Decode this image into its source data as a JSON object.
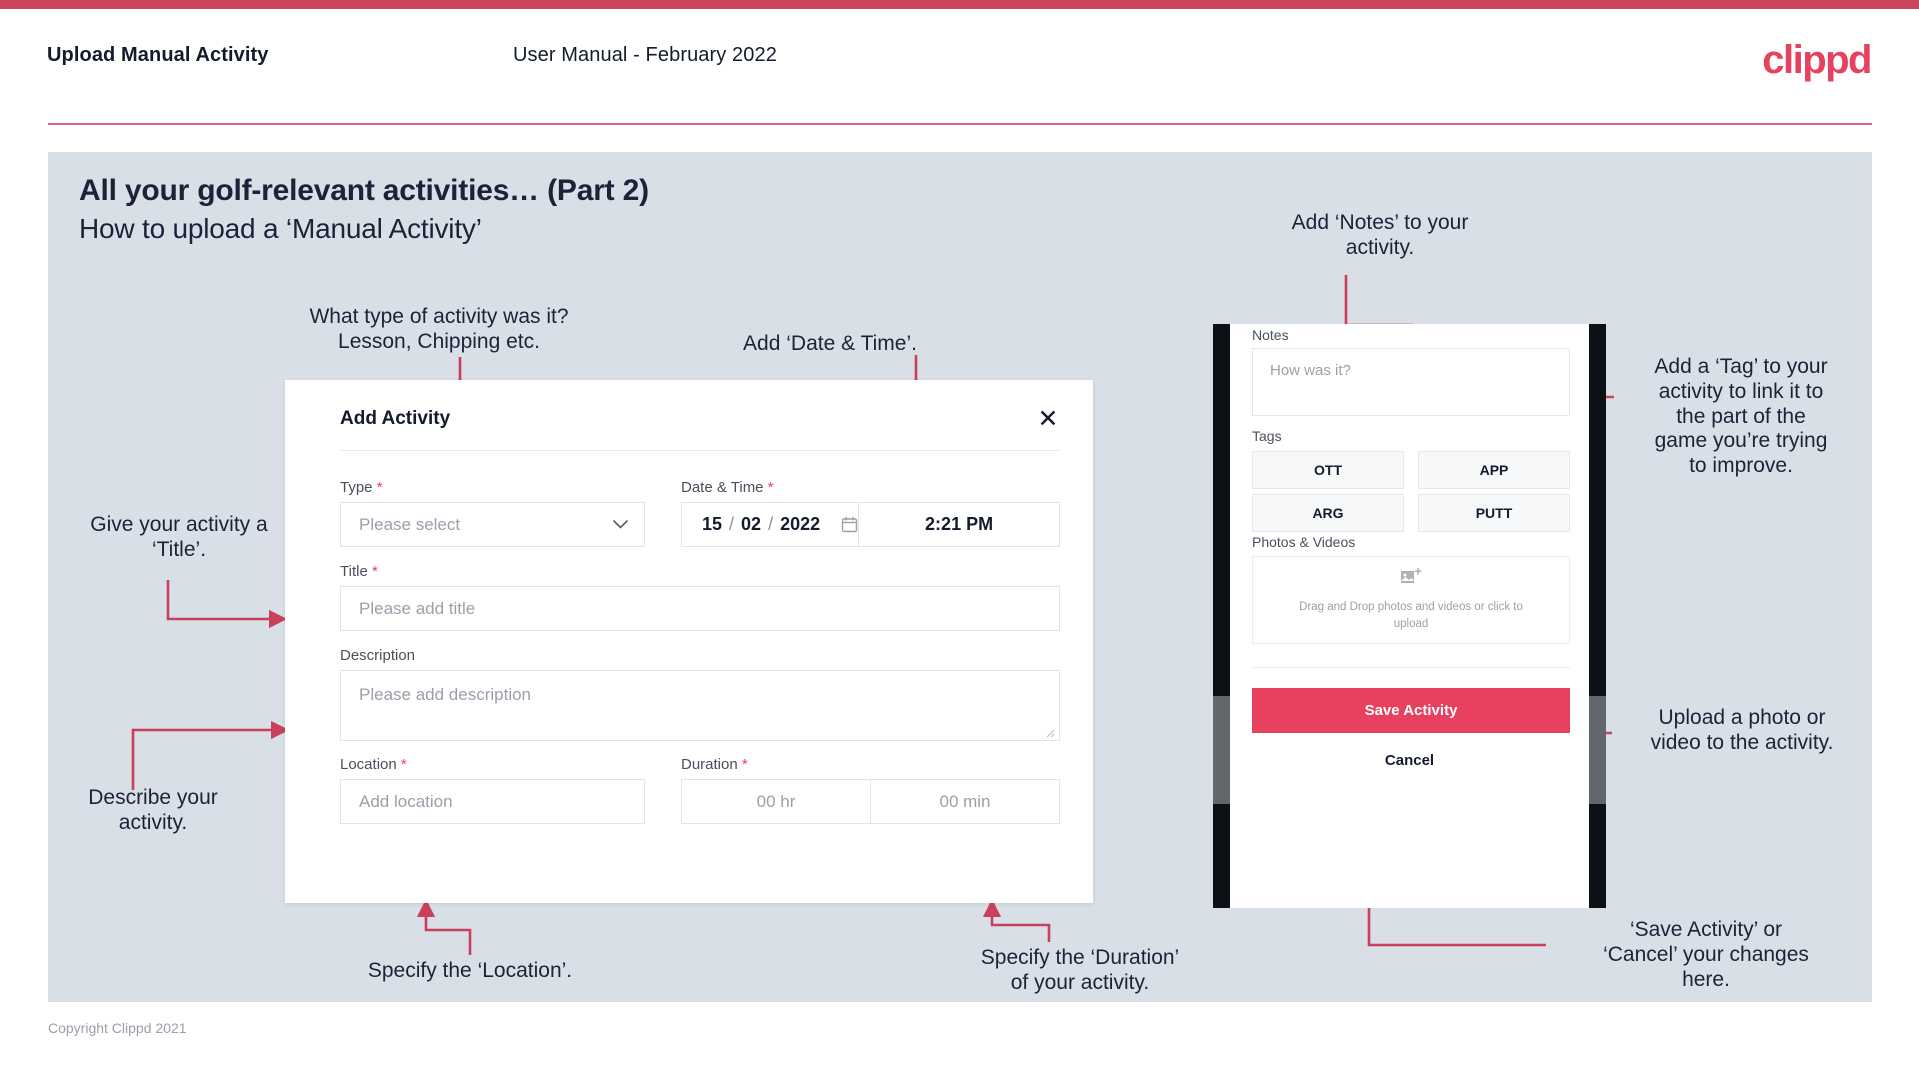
{
  "header": {
    "title": "Upload Manual Activity",
    "subtitle": "User Manual - February 2022",
    "logo": "clippd"
  },
  "slide": {
    "title": "All your golf-relevant activities… (Part 2)",
    "subtitle": "How to upload a ‘Manual Activity’"
  },
  "annotations": {
    "type": "What type of activity was it?\nLesson, Chipping etc.",
    "datetime": "Add ‘Date & Time’.",
    "title_field": "Give your activity a\n‘Title’.",
    "description": "Describe your\nactivity.",
    "location": "Specify the ‘Location’.",
    "duration": "Specify the ‘Duration’\nof your activity.",
    "notes": "Add ‘Notes’ to your\nactivity.",
    "tags": "Add a ‘Tag’ to your\nactivity to link it to\nthe part of the\ngame you’re trying\nto improve.",
    "photos": "Upload a photo or\nvideo to the activity.",
    "save": "‘Save Activity’ or\n‘Cancel’ your changes\nhere."
  },
  "dialog": {
    "title": "Add Activity",
    "close_icon": "close-icon",
    "fields": {
      "type": {
        "label": "Type",
        "required": true,
        "placeholder": "Please select",
        "value": ""
      },
      "datetime": {
        "label": "Date & Time",
        "required": true,
        "day": "15",
        "month": "02",
        "year": "2022",
        "separator": "/",
        "time": "2:21 PM",
        "calendar_icon": "calendar-icon"
      },
      "title": {
        "label": "Title",
        "required": true,
        "placeholder": "Please add title",
        "value": ""
      },
      "description": {
        "label": "Description",
        "required": false,
        "placeholder": "Please add description",
        "value": ""
      },
      "location": {
        "label": "Location",
        "required": true,
        "placeholder": "Add location",
        "value": ""
      },
      "duration": {
        "label": "Duration",
        "required": true,
        "hours_placeholder": "00 hr",
        "minutes_placeholder": "00 min"
      }
    }
  },
  "mobile": {
    "notes_label": "Notes",
    "notes_placeholder": "How was it?",
    "tags_label": "Tags",
    "tags": [
      "OTT",
      "APP",
      "ARG",
      "PUTT"
    ],
    "photos_label": "Photos & Videos",
    "drop_text": "Drag and Drop photos and videos or click to upload",
    "drop_icon": "add-image-icon",
    "save_label": "Save Activity",
    "cancel_label": "Cancel"
  },
  "footer": {
    "copyright": "Copyright Clippd 2021"
  },
  "colors": {
    "brand": "#e8405f",
    "top_bar": "#ce4560",
    "slide_bg": "#d9dfe7",
    "text_dark": "#141b2d",
    "connector": "#c9405c"
  }
}
